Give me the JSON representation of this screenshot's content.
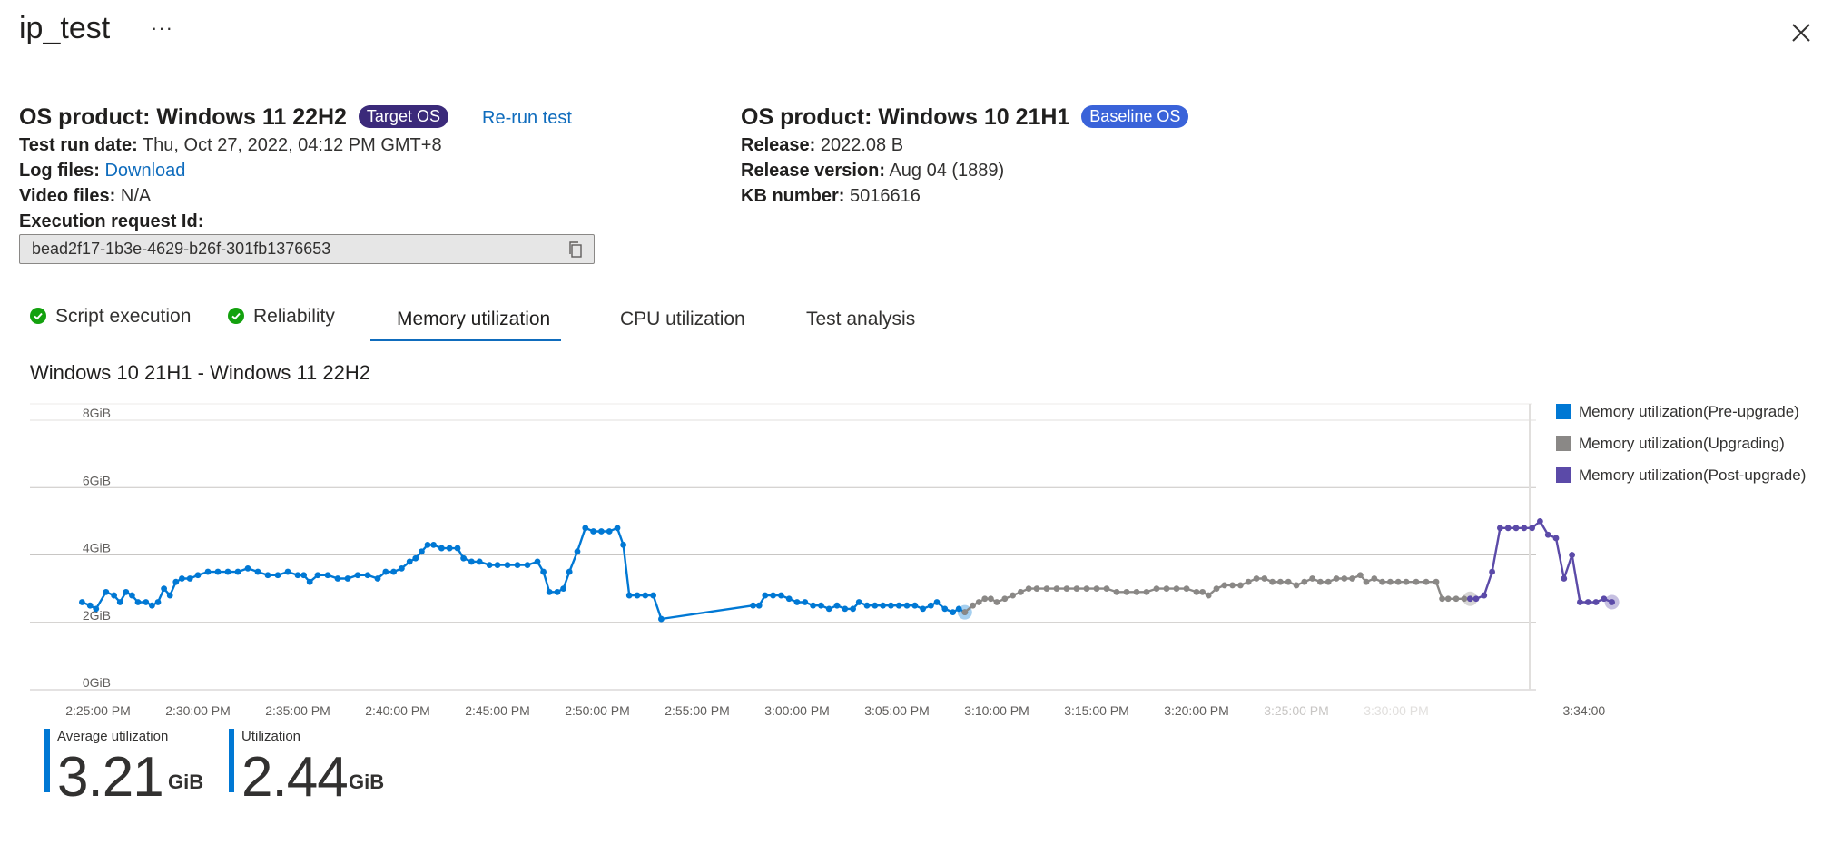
{
  "header": {
    "title": "ip_test",
    "more": "···"
  },
  "target": {
    "product_label": "OS product:",
    "product_value": "Windows 11 22H2",
    "badge": "Target OS",
    "rerun": "Re-run test",
    "run_date_label": "Test run date:",
    "run_date_value": "Thu, Oct 27, 2022, 04:12 PM GMT+8",
    "log_label": "Log files:",
    "log_value": "Download",
    "video_label": "Video files:",
    "video_value": "N/A",
    "exec_label": "Execution request Id:",
    "exec_value": "bead2f17-1b3e-4629-b26f-301fb1376653"
  },
  "baseline": {
    "product_label": "OS product:",
    "product_value": "Windows 10 21H1",
    "badge": "Baseline OS",
    "release_label": "Release:",
    "release_value": "2022.08 B",
    "version_label": "Release version:",
    "version_value": "Aug 04 (1889)",
    "kb_label": "KB number:",
    "kb_value": "5016616"
  },
  "tabs": [
    {
      "label": "Script execution"
    },
    {
      "label": "Reliability"
    },
    {
      "label": "Memory utilization"
    },
    {
      "label": "CPU utilization"
    },
    {
      "label": "Test analysis"
    }
  ],
  "chart_data": {
    "type": "line",
    "title": "Windows 10 21H1 - Windows 11 22H2",
    "y_ticks": [
      "8GiB",
      "6GiB",
      "4GiB",
      "2GiB",
      "0GiB"
    ],
    "ylim": [
      0,
      8
    ],
    "x_ticks": [
      "2:25:00 PM",
      "2:30:00 PM",
      "2:35:00 PM",
      "2:40:00 PM",
      "2:45:00 PM",
      "2:50:00 PM",
      "2:55:00 PM",
      "3:00:00 PM",
      "3:05:00 PM",
      "3:10:00 PM",
      "3:15:00 PM",
      "3:20:00 PM",
      "3:25:00 PM",
      "3:30:00 PM",
      "3:34:00"
    ],
    "x_unit": "minutes after 2:25:00 PM",
    "grid": true,
    "legend": "right",
    "series": [
      {
        "name": "Memory utilization(Pre-upgrade)",
        "color": "#0078d4",
        "points": [
          [
            -0.8,
            2.6
          ],
          [
            -0.4,
            2.5
          ],
          [
            -0.1,
            2.4
          ],
          [
            0.4,
            2.9
          ],
          [
            0.8,
            2.8
          ],
          [
            1.1,
            2.6
          ],
          [
            1.4,
            2.9
          ],
          [
            1.7,
            2.8
          ],
          [
            2.0,
            2.6
          ],
          [
            2.4,
            2.6
          ],
          [
            2.7,
            2.5
          ],
          [
            3.0,
            2.6
          ],
          [
            3.3,
            3.0
          ],
          [
            3.6,
            2.8
          ],
          [
            3.9,
            3.2
          ],
          [
            4.2,
            3.3
          ],
          [
            4.6,
            3.3
          ],
          [
            5.0,
            3.4
          ],
          [
            5.5,
            3.5
          ],
          [
            6.0,
            3.5
          ],
          [
            6.5,
            3.5
          ],
          [
            7.0,
            3.5
          ],
          [
            7.5,
            3.6
          ],
          [
            8.0,
            3.5
          ],
          [
            8.5,
            3.4
          ],
          [
            9.0,
            3.4
          ],
          [
            9.5,
            3.5
          ],
          [
            10.0,
            3.4
          ],
          [
            10.3,
            3.4
          ],
          [
            10.6,
            3.2
          ],
          [
            11.0,
            3.4
          ],
          [
            11.5,
            3.4
          ],
          [
            12.0,
            3.3
          ],
          [
            12.5,
            3.3
          ],
          [
            13.0,
            3.4
          ],
          [
            13.5,
            3.4
          ],
          [
            14.0,
            3.3
          ],
          [
            14.4,
            3.5
          ],
          [
            14.8,
            3.5
          ],
          [
            15.2,
            3.6
          ],
          [
            15.6,
            3.8
          ],
          [
            15.9,
            3.9
          ],
          [
            16.2,
            4.1
          ],
          [
            16.5,
            4.3
          ],
          [
            16.8,
            4.3
          ],
          [
            17.2,
            4.2
          ],
          [
            17.6,
            4.2
          ],
          [
            18.0,
            4.2
          ],
          [
            18.3,
            3.9
          ],
          [
            18.7,
            3.8
          ],
          [
            19.1,
            3.8
          ],
          [
            19.6,
            3.7
          ],
          [
            20.0,
            3.7
          ],
          [
            20.5,
            3.7
          ],
          [
            21.0,
            3.7
          ],
          [
            21.5,
            3.7
          ],
          [
            22.0,
            3.8
          ],
          [
            22.3,
            3.5
          ],
          [
            22.6,
            2.9
          ],
          [
            23.0,
            2.9
          ],
          [
            23.3,
            3.0
          ],
          [
            23.6,
            3.5
          ],
          [
            24.0,
            4.1
          ],
          [
            24.4,
            4.8
          ],
          [
            24.8,
            4.7
          ],
          [
            25.2,
            4.7
          ],
          [
            25.6,
            4.7
          ],
          [
            26.0,
            4.8
          ],
          [
            26.3,
            4.3
          ],
          [
            26.6,
            2.8
          ],
          [
            27.0,
            2.8
          ],
          [
            27.4,
            2.8
          ],
          [
            27.8,
            2.8
          ],
          [
            28.2,
            2.1
          ],
          [
            32.8,
            2.5
          ],
          [
            33.1,
            2.5
          ],
          [
            33.4,
            2.8
          ],
          [
            33.8,
            2.8
          ],
          [
            34.2,
            2.8
          ],
          [
            34.6,
            2.7
          ],
          [
            35.0,
            2.6
          ],
          [
            35.4,
            2.6
          ],
          [
            35.8,
            2.5
          ],
          [
            36.2,
            2.5
          ],
          [
            36.6,
            2.4
          ],
          [
            37.0,
            2.5
          ],
          [
            37.4,
            2.4
          ],
          [
            37.8,
            2.4
          ],
          [
            38.1,
            2.6
          ],
          [
            38.5,
            2.5
          ],
          [
            38.9,
            2.5
          ],
          [
            39.3,
            2.5
          ],
          [
            39.7,
            2.5
          ],
          [
            40.1,
            2.5
          ],
          [
            40.5,
            2.5
          ],
          [
            40.9,
            2.5
          ],
          [
            41.3,
            2.4
          ],
          [
            41.7,
            2.5
          ],
          [
            42.0,
            2.6
          ],
          [
            42.4,
            2.4
          ],
          [
            42.8,
            2.3
          ],
          [
            43.1,
            2.4
          ],
          [
            43.4,
            2.3
          ]
        ]
      },
      {
        "name": "Memory utilization(Upgrading)",
        "color": "#8a8886",
        "points": [
          [
            43.4,
            2.3
          ],
          [
            43.8,
            2.5
          ],
          [
            44.1,
            2.6
          ],
          [
            44.4,
            2.7
          ],
          [
            44.7,
            2.7
          ],
          [
            45.0,
            2.6
          ],
          [
            45.4,
            2.7
          ],
          [
            45.8,
            2.8
          ],
          [
            46.2,
            2.9
          ],
          [
            46.6,
            3.0
          ],
          [
            47.0,
            3.0
          ],
          [
            47.5,
            3.0
          ],
          [
            48.0,
            3.0
          ],
          [
            48.5,
            3.0
          ],
          [
            49.0,
            3.0
          ],
          [
            49.5,
            3.0
          ],
          [
            50.0,
            3.0
          ],
          [
            50.5,
            3.0
          ],
          [
            51.0,
            2.9
          ],
          [
            51.5,
            2.9
          ],
          [
            52.0,
            2.9
          ],
          [
            52.5,
            2.9
          ],
          [
            53.0,
            3.0
          ],
          [
            53.5,
            3.0
          ],
          [
            54.0,
            3.0
          ],
          [
            54.5,
            3.0
          ],
          [
            55.0,
            2.9
          ],
          [
            55.3,
            2.9
          ],
          [
            55.6,
            2.8
          ],
          [
            56.0,
            3.0
          ],
          [
            56.4,
            3.1
          ],
          [
            56.8,
            3.1
          ],
          [
            57.2,
            3.1
          ],
          [
            57.6,
            3.2
          ],
          [
            58.0,
            3.3
          ],
          [
            58.4,
            3.3
          ],
          [
            58.8,
            3.2
          ],
          [
            59.2,
            3.2
          ],
          [
            59.6,
            3.2
          ],
          [
            60.0,
            3.1
          ],
          [
            60.4,
            3.2
          ],
          [
            60.8,
            3.3
          ],
          [
            61.2,
            3.2
          ],
          [
            61.6,
            3.2
          ],
          [
            62.0,
            3.3
          ],
          [
            62.4,
            3.3
          ],
          [
            62.8,
            3.3
          ],
          [
            63.2,
            3.4
          ],
          [
            63.5,
            3.2
          ],
          [
            63.9,
            3.3
          ],
          [
            64.3,
            3.2
          ],
          [
            64.7,
            3.2
          ],
          [
            65.1,
            3.2
          ],
          [
            65.5,
            3.2
          ],
          [
            66.0,
            3.2
          ],
          [
            66.5,
            3.2
          ],
          [
            67.0,
            3.2
          ],
          [
            67.3,
            2.7
          ],
          [
            67.6,
            2.7
          ],
          [
            68.0,
            2.7
          ],
          [
            68.4,
            2.7
          ],
          [
            68.7,
            2.7
          ]
        ]
      },
      {
        "name": "Memory utilization(Post-upgrade)",
        "color": "#5b4aa8",
        "points": [
          [
            68.7,
            2.7
          ],
          [
            69.0,
            2.7
          ],
          [
            69.4,
            2.8
          ],
          [
            69.8,
            3.5
          ],
          [
            70.2,
            4.8
          ],
          [
            70.6,
            4.8
          ],
          [
            71.0,
            4.8
          ],
          [
            71.4,
            4.8
          ],
          [
            71.8,
            4.8
          ],
          [
            72.2,
            5.0
          ],
          [
            72.6,
            4.6
          ],
          [
            73.0,
            4.5
          ],
          [
            73.4,
            3.3
          ],
          [
            73.8,
            4.0
          ],
          [
            74.2,
            2.6
          ],
          [
            74.6,
            2.6
          ],
          [
            75.0,
            2.6
          ],
          [
            75.4,
            2.7
          ],
          [
            75.8,
            2.6
          ]
        ]
      }
    ]
  },
  "kpis": [
    {
      "label": "Average utilization",
      "value": "3.21",
      "unit": "GiB"
    },
    {
      "label": "Utilization",
      "value": "2.44",
      "unit": "GiB"
    }
  ]
}
